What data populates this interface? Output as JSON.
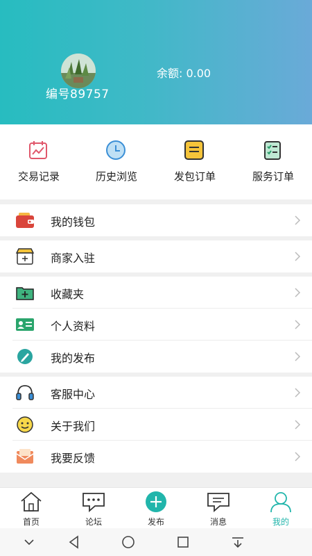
{
  "profile": {
    "member_id": "编号89757",
    "balance": "余额: 0.00"
  },
  "shortcuts": [
    {
      "label": "交易记录",
      "icon": "calendar-chart-icon"
    },
    {
      "label": "历史浏览",
      "icon": "clock-icon"
    },
    {
      "label": "发包订单",
      "icon": "note-icon"
    },
    {
      "label": "服务订单",
      "icon": "checklist-icon"
    }
  ],
  "menu": {
    "wallet": "我的钱包",
    "merchant": "商家入驻",
    "favorites": "收藏夹",
    "profile": "个人资料",
    "my_posts": "我的发布",
    "service_center": "客服中心",
    "about_us": "关于我们",
    "feedback": "我要反馈"
  },
  "tabbar": [
    {
      "label": "首页",
      "icon": "home-icon"
    },
    {
      "label": "论坛",
      "icon": "forum-icon"
    },
    {
      "label": "发布",
      "icon": "plus-circle-icon"
    },
    {
      "label": "消息",
      "icon": "message-icon"
    },
    {
      "label": "我的",
      "icon": "person-icon",
      "active": true
    }
  ],
  "colors": {
    "header_start": "#27bcc0",
    "header_end": "#6aaad8",
    "accent": "#21b5ab"
  }
}
